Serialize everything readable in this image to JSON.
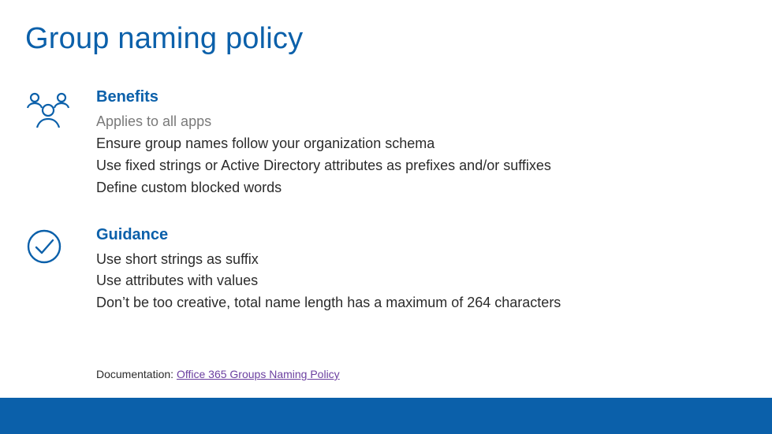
{
  "title": "Group naming policy",
  "sections": {
    "benefits": {
      "heading": "Benefits",
      "lines": [
        "Applies to all apps",
        "Ensure group names follow your organization schema",
        "Use fixed strings or Active Directory attributes as prefixes and/or suffixes",
        "Define custom blocked words"
      ]
    },
    "guidance": {
      "heading": "Guidance",
      "lines": [
        "Use short strings as suffix",
        "Use attributes with values",
        "Don’t be too creative, total name length has a maximum of 264 characters"
      ]
    }
  },
  "documentation": {
    "label": "Documentation: ",
    "link_text": "Office 365 Groups Naming Policy"
  },
  "colors": {
    "accent": "#0b60aa",
    "link": "#6b3fa0"
  }
}
